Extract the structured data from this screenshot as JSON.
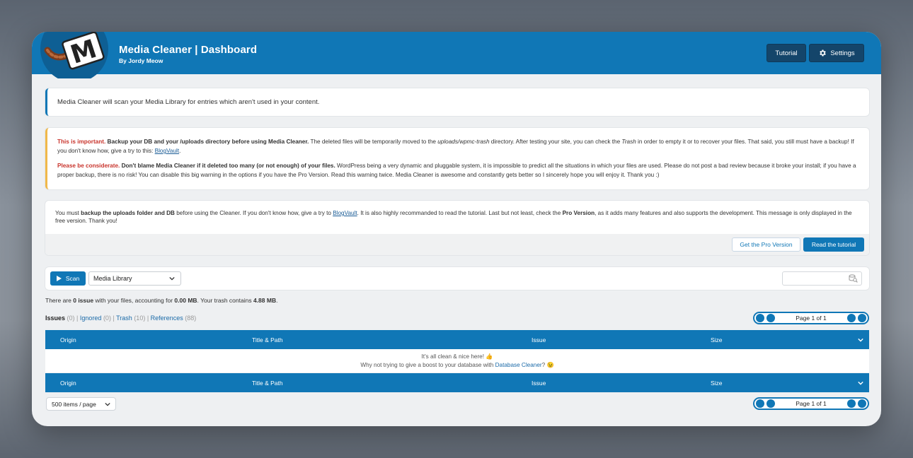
{
  "header": {
    "title": "Media Cleaner | Dashboard",
    "subtitle": "By Jordy Meow",
    "tutorial_label": "Tutorial",
    "settings_label": "Settings",
    "logo_letter": "M",
    "accent": "#1077b6"
  },
  "intro": {
    "text": "Media Cleaner will scan your Media Library for entries which aren't used in your content."
  },
  "warning": {
    "p1_red": "This is important.",
    "p1_bold": "Backup your DB and your /uploads directory before using Media Cleaner.",
    "p1_a": "The deleted files will be temporarily moved to the",
    "p1_path": "uploads/wpmc-trash",
    "p1_b": "directory. After testing your site, you can check the",
    "p1_trash": "Trash",
    "p1_c": "in order to empty it or to recover your files. That said, you still must have a backup! If you don't know how, give a try to this:",
    "p1_link": "BlogVault",
    "p2_red": "Please be considerate.",
    "p2_bold": "Don't blame Media Cleaner if it deleted too many (or not enough) of your files.",
    "p2_text": "WordPress being a very dynamic and pluggable system, it is impossible to predict all the situations in which your files are used. Please do not post a bad review because it broke your install; if you have a proper backup, there is no risk! You can disable this big warning in the options if you have the Pro Version. Read this warning twice. Media Cleaner is awesome and constantly gets better so I sincerely hope you will enjoy it. Thank you :)",
    "accent": "#f0b849"
  },
  "free_notice": {
    "a": "You must",
    "b_bold": "backup the uploads folder and DB",
    "c": "before using the Cleaner. If you don't know how, give a try to",
    "link": "BlogVault",
    "d": ". It is also highly recommanded to read the tutorial. Last but not least, check the",
    "pro_bold": "Pro Version",
    "e": ", as it adds many features and also supports the development. This message is only displayed in the free version. Thank you!",
    "pro_button": "Get the Pro Version",
    "tutorial_button": "Read the tutorial"
  },
  "toolbar": {
    "scan_label": "Scan",
    "source_selected": "Media Library",
    "search_placeholder": ""
  },
  "summary": {
    "a": "There are",
    "issues_bold": "0 issue",
    "b": "with your files, accounting for",
    "size_bold": "0.00 MB",
    "c": ". Your trash contains",
    "trash_bold": "4.88 MB",
    "d": "."
  },
  "filters": {
    "issues": "Issues",
    "issues_count": "(0)",
    "ignored": "Ignored",
    "ignored_count": "(0)",
    "trash": "Trash",
    "trash_count": "(10)",
    "references": "References",
    "references_count": "(88)"
  },
  "pager": {
    "text": "Page 1 of 1"
  },
  "table": {
    "columns": [
      "Origin",
      "Title & Path",
      "Issue",
      "Size"
    ],
    "empty_line1": "It's all clean & nice here! 👍",
    "empty_line2_a": "Why not trying to give a boost to your database with",
    "empty_line2_link": "Database Cleaner",
    "empty_line2_b": "? 😉"
  },
  "per_page": "500 items / page"
}
